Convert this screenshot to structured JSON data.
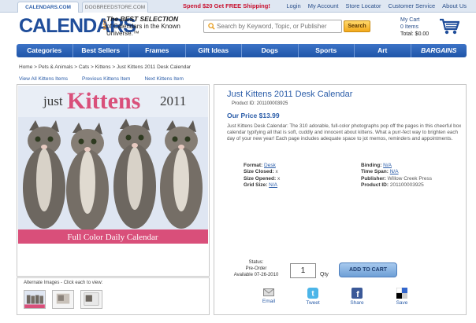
{
  "topbar": {
    "tabs": [
      "CALENDARS.COM",
      "DOGBREEDSTORE.COM"
    ],
    "promo": "Spend $20 Get FREE Shipping!",
    "links": [
      "Login",
      "My Account",
      "Store Locator",
      "Customer Service",
      "About Us"
    ]
  },
  "header": {
    "logo": "CALENDARS",
    "logo_suffix": ".com",
    "tagline_bold": "The BEST SELECTION",
    "tagline_rest": "of Calendars in the Known Universe.™",
    "search": {
      "placeholder": "Search by Keyword, Topic, or Publisher",
      "button": "Search"
    },
    "cart": {
      "title": "My Cart",
      "items": "0 Items",
      "total": "Total: $0.00"
    }
  },
  "nav": [
    "Categories",
    "Best Sellers",
    "Frames",
    "Gift Ideas",
    "Dogs",
    "Sports",
    "Art",
    "BARGAINS"
  ],
  "breadcrumb": "Home > Pets & Animals > Cats > Kittens > Just Kittens 2011 Desk Calendar",
  "product_nav": [
    "View All Kittens Items",
    "Previous Kittens Item",
    "Next Kittens Item"
  ],
  "cover": {
    "top": "just",
    "main": "Kittens",
    "year": "2011",
    "banner": "Full Color Daily Calendar"
  },
  "alternate_label": "Alternate Images - Click each to view:",
  "product": {
    "title": "Just Kittens 2011 Desk Calendar",
    "product_id_line": "Product ID: 201100003925",
    "price": "Our Price $13.99",
    "description": "Just Kittens Desk Calendar: The 310 adorable, full-color photographs pop off the pages in this cheerful box calendar typifying all that is soft, cuddly and innocent about kittens. What a purr-fect way to brighten each day of your new year! Each page includes adequate space to jot memos, reminders and appointments."
  },
  "specs_left": [
    {
      "label": "Format:",
      "value": "Desk"
    },
    {
      "label": "Size Closed:",
      "value": "x"
    },
    {
      "label": "Size Opened:",
      "value": "x"
    },
    {
      "label": "Grid Size:",
      "value": "N/A"
    }
  ],
  "specs_right": [
    {
      "label": "Binding:",
      "value": "N/A"
    },
    {
      "label": "Time Span:",
      "value": "N/A"
    },
    {
      "label": "Publisher:",
      "value": "Willow Creek Press"
    },
    {
      "label": "Product ID:",
      "value": "201100003925"
    }
  ],
  "purchase": {
    "status_label": "Status:",
    "status_value": "Pre-Order",
    "available": "Available 07-26-2010",
    "quantity": "1",
    "qty_label": "Qty",
    "add_to_cart": "ADD TO CART"
  },
  "share": [
    "Email",
    "Tweet",
    "Share",
    "Save"
  ],
  "colors": {
    "brand_blue": "#1f4d9a",
    "accent_pink": "#d94f7a",
    "promo_red": "#c8102e"
  }
}
